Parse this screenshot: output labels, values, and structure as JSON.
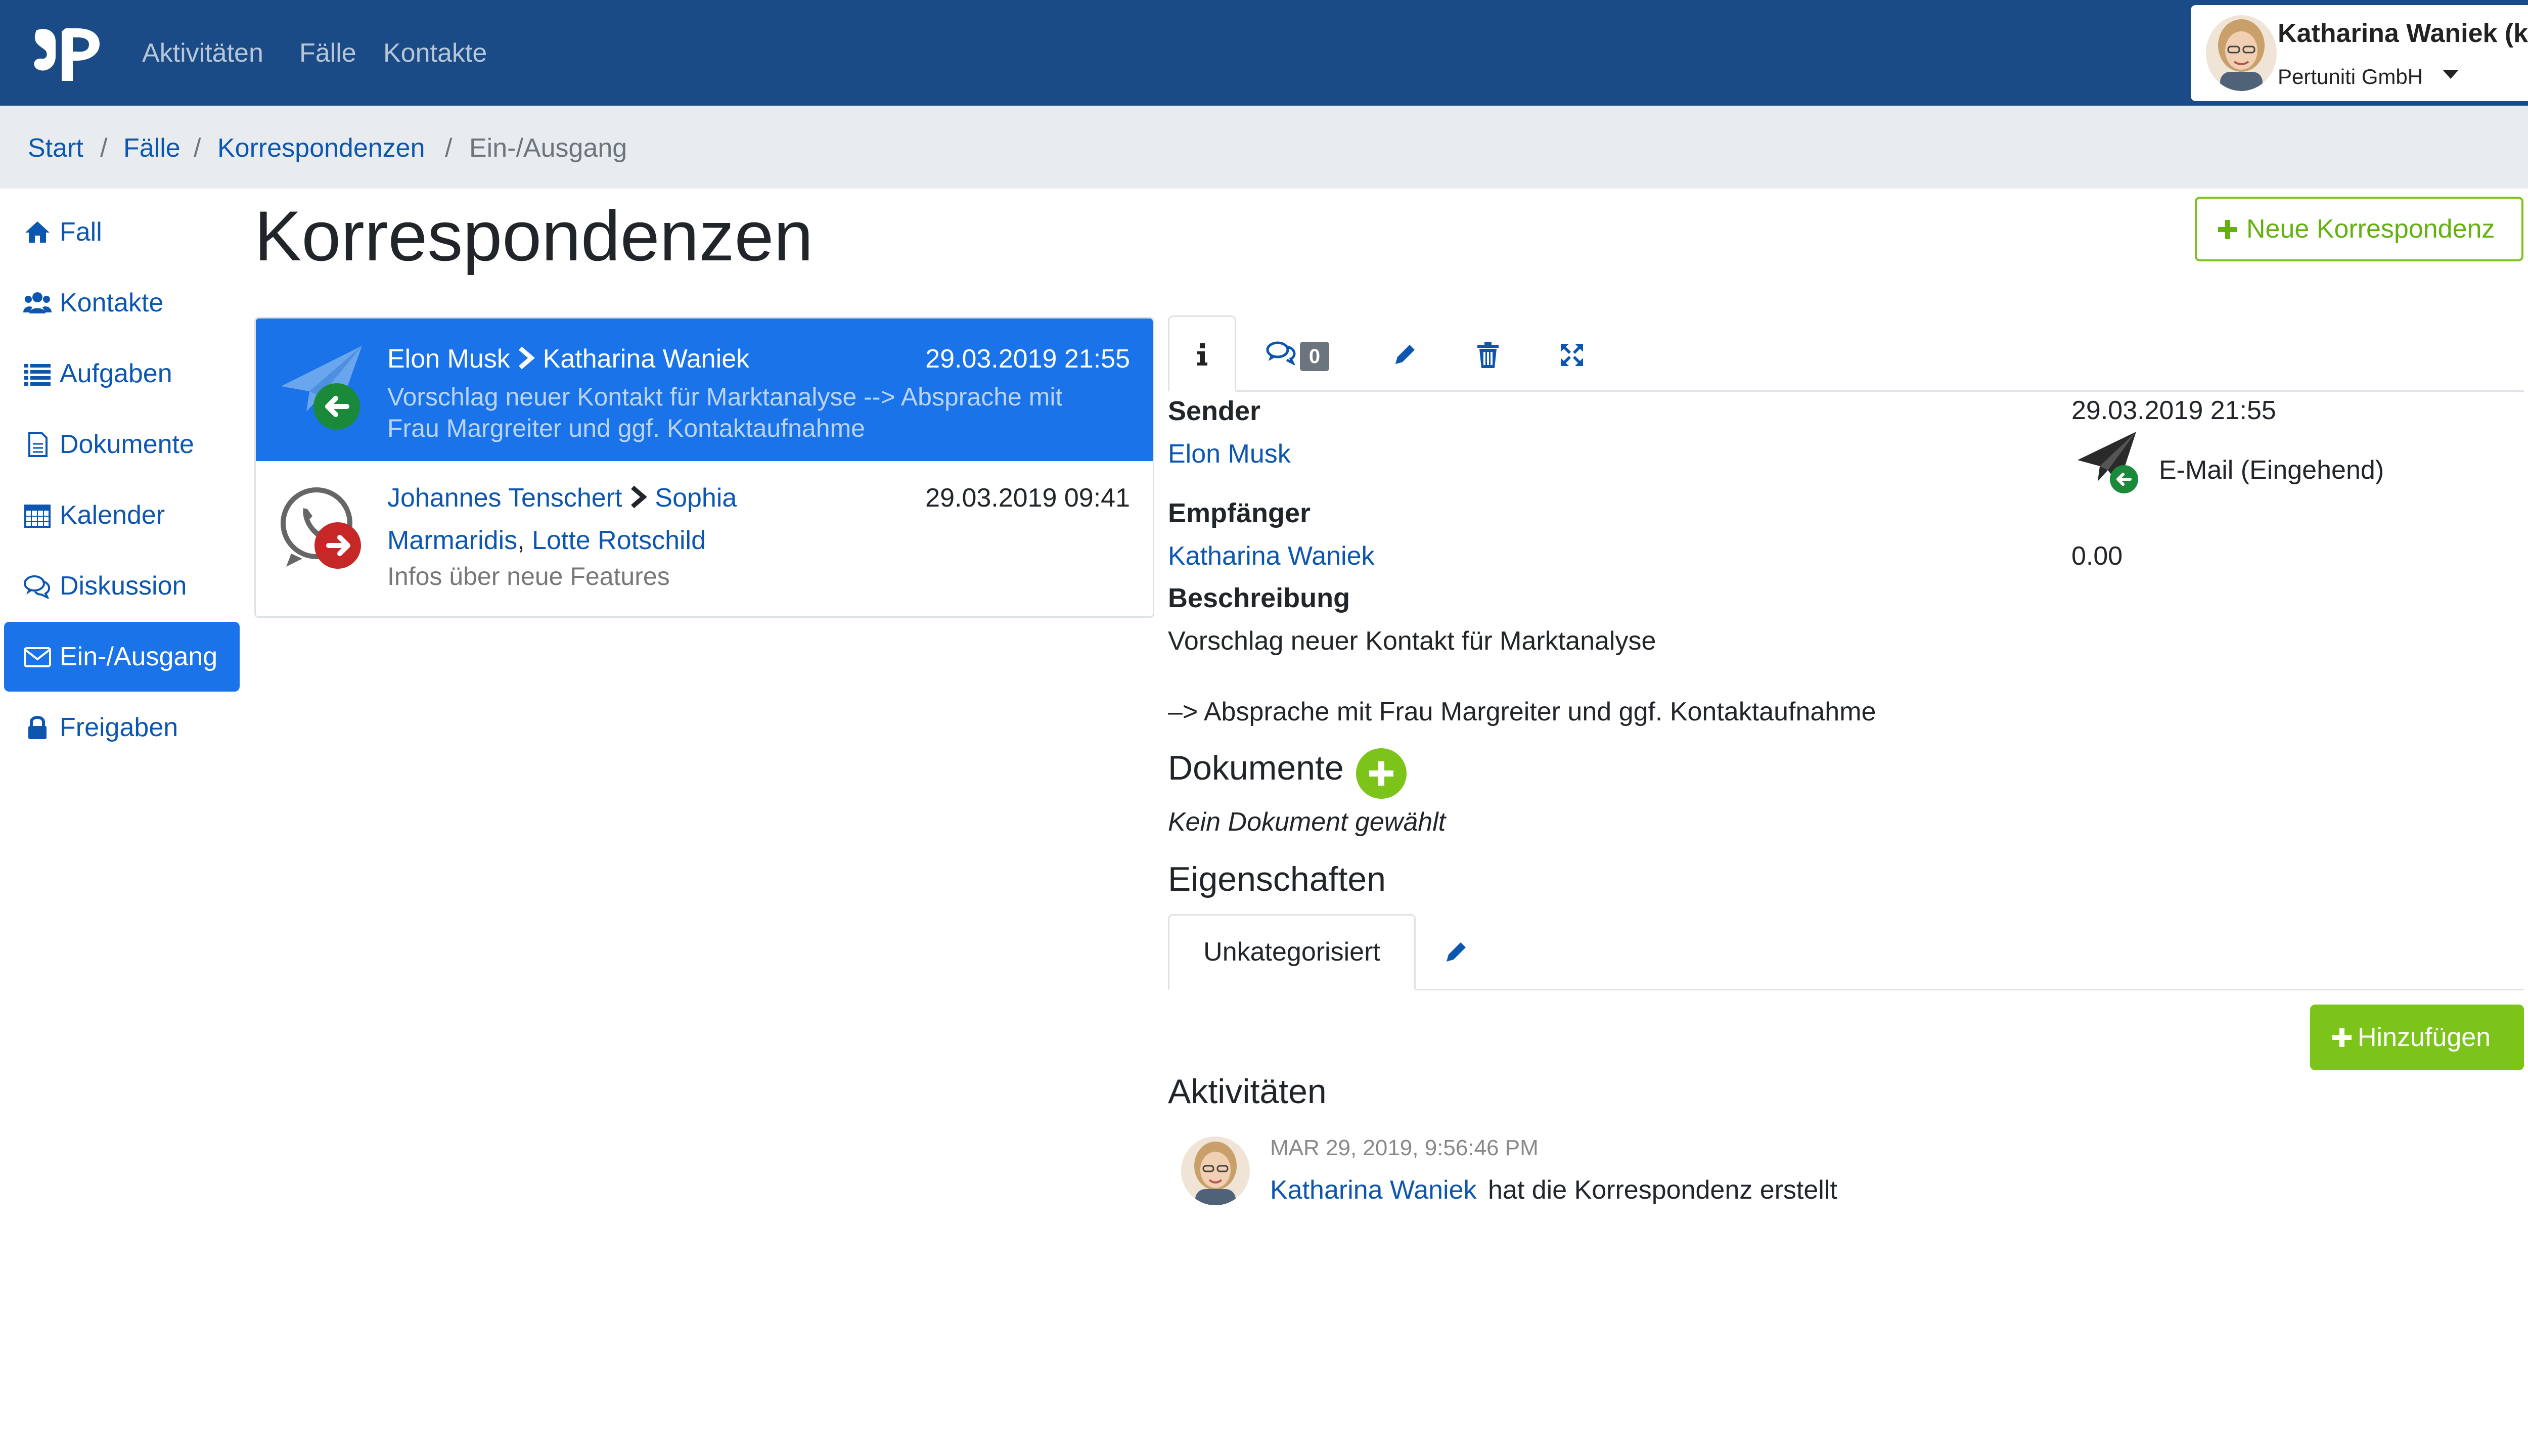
{
  "navbar": {
    "nav_items": [
      "Aktivitäten",
      "Fälle",
      "Kontakte"
    ],
    "user_name": "Katharina Waniek (kw)",
    "user_org": "Pertuniti GmbH"
  },
  "breadcrumb": {
    "items": [
      "Start",
      "Fälle",
      "Korrespondenzen"
    ],
    "active": "Ein-/Ausgang",
    "separator": "/"
  },
  "sidebar": {
    "items": [
      {
        "label": "Fall",
        "icon": "home-icon"
      },
      {
        "label": "Kontakte",
        "icon": "users-icon"
      },
      {
        "label": "Aufgaben",
        "icon": "list-icon"
      },
      {
        "label": "Dokumente",
        "icon": "document-icon"
      },
      {
        "label": "Kalender",
        "icon": "calendar-icon"
      },
      {
        "label": "Diskussion",
        "icon": "comments-icon"
      },
      {
        "label": "Ein-/Ausgang",
        "icon": "envelope-icon",
        "active": true
      },
      {
        "label": "Freigaben",
        "icon": "lock-icon"
      }
    ]
  },
  "page": {
    "title": "Korrespondenzen",
    "new_button": "Neue Korrespondenz"
  },
  "list": [
    {
      "from": "Elon Musk",
      "to": "Katharina Waniek",
      "date": "29.03.2019 21:55",
      "desc_line1": "Vorschlag neuer Kontakt für Marktanalyse --> Absprache mit",
      "desc_line2": "Frau Margreiter und ggf. Kontaktaufnahme",
      "icon": "email-incoming-icon"
    },
    {
      "from": "Johannes Tenschert",
      "to_first": "Sophia",
      "to_line2a": "Marmaridis",
      "to_line2b": "Lotte Rotschild",
      "date": "29.03.2019 09:41",
      "desc": "Infos über neue Features",
      "icon": "phone-outgoing-icon"
    }
  ],
  "detail": {
    "comment_count": "0",
    "sender_label": "Sender",
    "sender": "Elon Musk",
    "date": "29.03.2019 21:55",
    "type": "E-Mail (Eingehend)",
    "recipient_label": "Empfänger",
    "recipient": "Katharina Waniek",
    "amount": "0.00",
    "description_label": "Beschreibung",
    "description_line1": "Vorschlag neuer Kontakt für Marktanalyse",
    "description_line2": "–> Absprache mit Frau Margreiter und ggf. Kontaktaufnahme",
    "documents_heading": "Dokumente",
    "documents_empty": "Kein Dokument gewählt",
    "properties_heading": "Eigenschaften",
    "properties_tab": "Unkategorisiert",
    "add_button": "Hinzufügen",
    "activities_heading": "Aktivitäten",
    "activity_time": "MAR 29, 2019, 9:56:46 PM",
    "activity_user": "Katharina Waniek",
    "activity_text": "hat die Korrespondenz erstellt"
  },
  "colors": {
    "navbar": "#1a4b86",
    "primary": "#1a73e8",
    "link": "#0d56b0",
    "success": "#7cc41a"
  }
}
